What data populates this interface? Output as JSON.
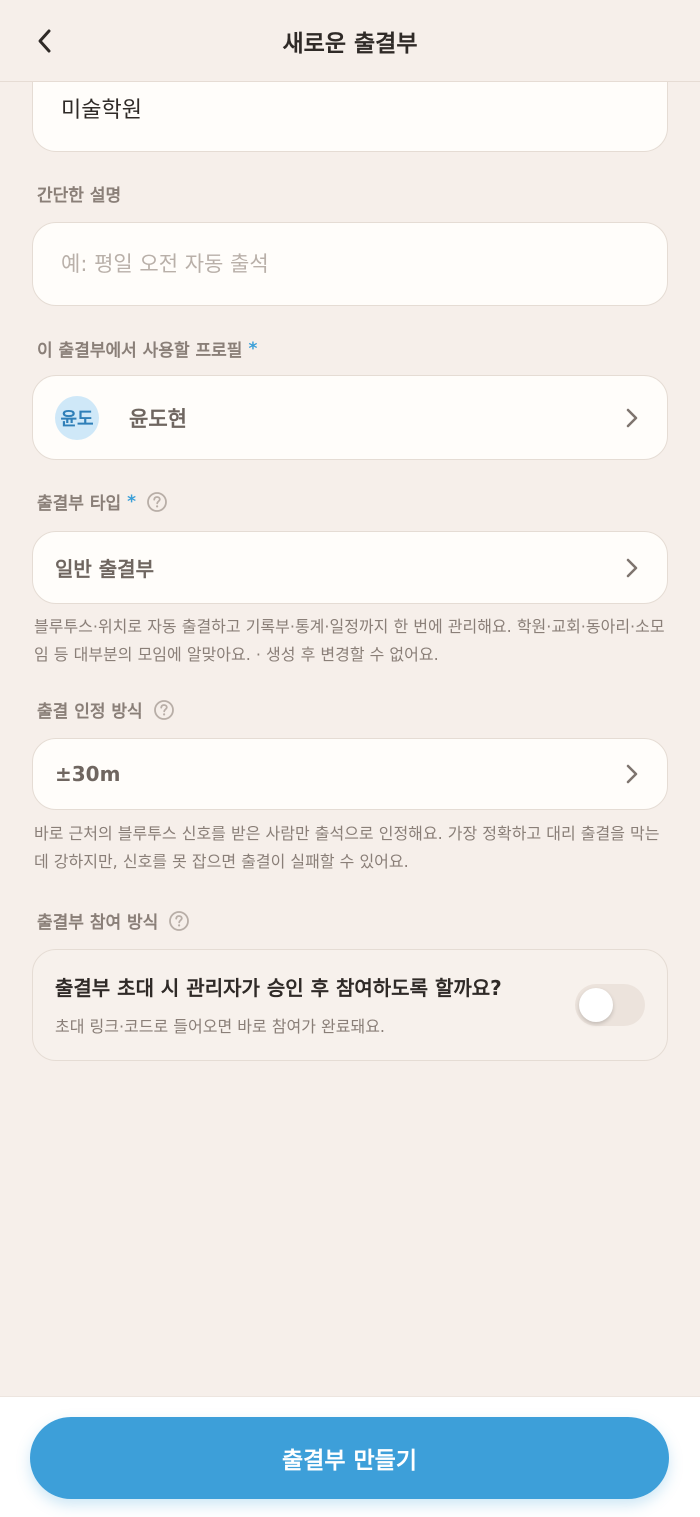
{
  "header": {
    "title": "새로운 출결부"
  },
  "name_field": {
    "value": "미술학원"
  },
  "description": {
    "label": "간단한 설명",
    "placeholder": "예: 평일 오전 자동 출석"
  },
  "profile": {
    "label": "이 출결부에서 사용할 프로필",
    "required_mark": "*",
    "avatar_text": "윤도",
    "name": "윤도현"
  },
  "type": {
    "label": "출결부 타입",
    "required_mark": "*",
    "value": "일반 출결부",
    "description": "블루투스·위치로 자동 출결하고 기록부·통계·일정까지 한 번에 관리해요. 학원·교회·동아리·소모임 등 대부분의 모임에 알맞아요. · 생성 후 변경할 수 없어요."
  },
  "method": {
    "label": "출결 인정 방식",
    "value": "±30m",
    "description": "바로 근처의 블루투스 신호를 받은 사람만 출석으로 인정해요. 가장 정확하고 대리 출결을 막는 데 강하지만, 신호를 못 잡으면 출결이 실패할 수 있어요."
  },
  "participation": {
    "label": "출결부 참여 방식",
    "title": "출결부 초대 시 관리자가 승인 후 참여하도록 할까요?",
    "subtitle": "초대 링크·코드로 들어오면 바로 참여가 완료돼요.",
    "enabled": false
  },
  "footer": {
    "submit_label": "출결부 만들기"
  },
  "colors": {
    "accent": "#3d9fd9",
    "background": "#f6efea",
    "card": "#fffdfa"
  }
}
